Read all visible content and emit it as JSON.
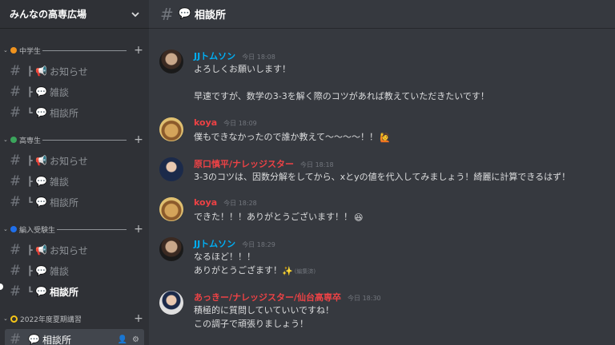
{
  "server": {
    "name": "みんなの高専広場"
  },
  "categories": [
    {
      "label": "中学生",
      "dot_color": "#f0931e",
      "channels": [
        {
          "emoji": "📢",
          "name": "お知らせ"
        },
        {
          "emoji": "💬",
          "name": "雑談"
        },
        {
          "emoji": "",
          "name": "相談所"
        }
      ]
    },
    {
      "label": "高専生",
      "dot_color": "#3ba55c",
      "channels": [
        {
          "emoji": "📢",
          "name": "お知らせ"
        },
        {
          "emoji": "💬",
          "name": "雑談"
        },
        {
          "emoji": "",
          "name": "相談所"
        }
      ]
    },
    {
      "label": "編入受験生",
      "dot_color": "#1f6feb",
      "channels": [
        {
          "emoji": "📢",
          "name": "お知らせ"
        },
        {
          "emoji": "💬",
          "name": "雑談"
        },
        {
          "emoji": "",
          "name": "相談所"
        }
      ]
    },
    {
      "label": "2022年度夏期講習",
      "dot_color": "#f5c518",
      "channels": [
        {
          "emoji": "💬",
          "name": "相談所"
        }
      ]
    }
  ],
  "channel": {
    "emoji": "💬",
    "name": "相談所"
  },
  "messages": [
    {
      "user": "JJトムソン",
      "color": "#00aff4",
      "time": "今日 18:08",
      "lines": [
        "よろしくお願いします！",
        "",
        "早速ですが、数学の3-3を解く際のコツがあれば教えていただきたいです！"
      ]
    },
    {
      "user": "koya",
      "color": "#ed4245",
      "time": "今日 18:09",
      "lines": [
        "僕もできなかったので誰か教えて〜〜〜〜！！"
      ]
    },
    {
      "user": "原口慎平/ナレッジスター",
      "color": "#ed4245",
      "time": "今日 18:18",
      "lines": [
        "3-3のコツは、因数分解をしてから、xとyの値を代入してみましょう！綺麗に計算できるはず！"
      ]
    },
    {
      "user": "koya",
      "color": "#ed4245",
      "time": "今日 18:28",
      "lines": [
        "できた！！！ありがとうございます！！"
      ]
    },
    {
      "user": "JJトムソン",
      "color": "#00aff4",
      "time": "今日 18:29",
      "lines": [
        "なるほど！！！",
        "ありがとうござます！"
      ],
      "edited": "(編集済)"
    },
    {
      "user": "あっきー/ナレッジスター/仙台高専卒",
      "color": "#ed4245",
      "time": "今日 18:30",
      "lines": [
        "積極的に質問していていいですね！",
        "この調子で頑張りましょう！"
      ]
    }
  ]
}
